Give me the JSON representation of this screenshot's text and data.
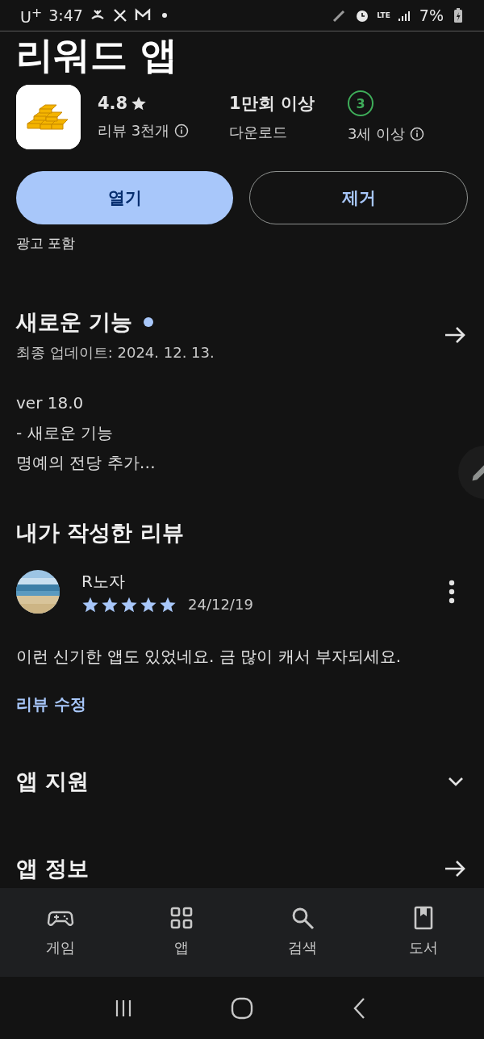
{
  "status_bar": {
    "carrier": "U$^{+}$",
    "time": "3:47",
    "network": "LTE",
    "battery": "7%"
  },
  "app": {
    "title": "리워드 앱",
    "rating": "4.8",
    "reviews": "리뷰 3천개",
    "downloads": "1만회 이상",
    "downloads_label": "다운로드",
    "age_badge": "3",
    "age_label": "3세 이상"
  },
  "buttons": [
    {
      "label": "열기",
      "kind": "primary"
    },
    {
      "label": "제거",
      "kind": "outlined"
    }
  ],
  "ads_note": "광고 포함",
  "whats_new": {
    "title": "새로운 기능",
    "new": true,
    "updated": "최종 업데이트: 2024. 12. 13.",
    "notes": [
      "ver 18.0",
      "- 새로운 기능",
      "명예의 전당 추가…"
    ]
  },
  "my_review": {
    "heading": "내가 작성한 리뷰",
    "reviewer": "R노자",
    "stars": 5,
    "date": "24/12/19",
    "text": "이런 신기한 앱도 있었네요. 금 많이 캐서 부자되세요.",
    "edit_link": "리뷰 수정"
  },
  "sections": [
    {
      "title": "앱 지원",
      "kind": "expand"
    },
    {
      "title": "앱 정보",
      "kind": "link"
    }
  ],
  "bottom_nav": [
    {
      "label": "게임",
      "kind": "games",
      "selected": false
    },
    {
      "label": "앱",
      "kind": "apps",
      "selected": false
    },
    {
      "label": "검색",
      "kind": "search",
      "selected": false
    },
    {
      "label": "도서",
      "kind": "books",
      "selected": false
    }
  ]
}
